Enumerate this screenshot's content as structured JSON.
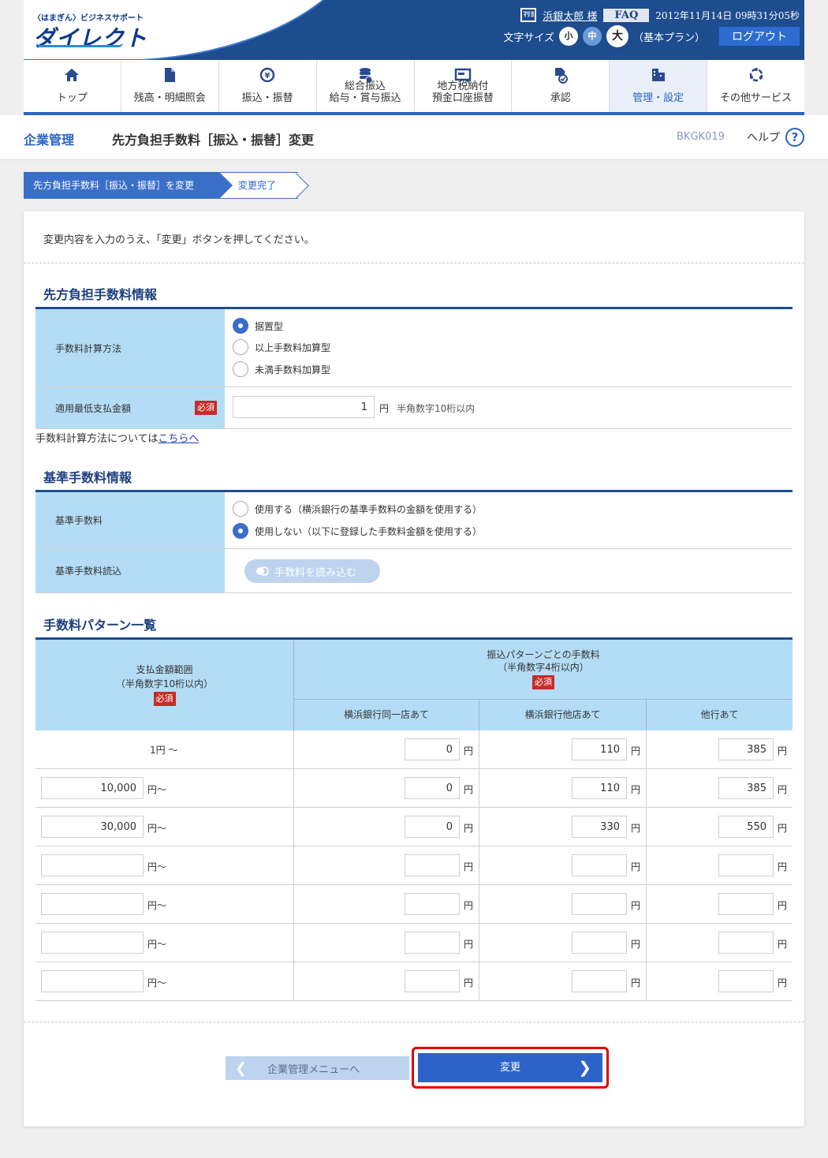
{
  "header": {
    "logo_small": "〈はまぎん〉ビジネスサポート",
    "logo_big": "ダイレクト",
    "user_icon_text": "ﾏﾘﾖ",
    "user_name": "浜銀太郎 様",
    "faq": "FAQ",
    "datetime": "2012年11月14日 09時31分05秒",
    "font_size_label": "文字サイズ",
    "font_small": "小",
    "font_mid": "中",
    "font_large": "大",
    "plan": "（基本プラン）",
    "logout": "ログアウト"
  },
  "nav": {
    "items": [
      {
        "label": "トップ",
        "icon": "home-icon"
      },
      {
        "label": "残高・明細照会",
        "icon": "document-icon"
      },
      {
        "label": "振込・振替",
        "icon": "yen-transfer-icon"
      },
      {
        "label": "総合振込\n給与・賞与振込",
        "icon": "coin-stack-icon"
      },
      {
        "label": "地方税納付\n預金口座振替",
        "icon": "card-icon"
      },
      {
        "label": "承認",
        "icon": "approval-icon"
      },
      {
        "label": "管理・設定",
        "icon": "settings-building-icon"
      },
      {
        "label": "その他サービス",
        "icon": "services-icon"
      }
    ]
  },
  "titlebar": {
    "crumb": "企業管理",
    "title": "先方負担手数料［振込・振替］変更",
    "screen_id": "BKGK019",
    "help": "ヘルプ",
    "help_icon": "?"
  },
  "steps": {
    "step1": "先方負担手数料［振込・振替］を変更",
    "step2": "変更完了"
  },
  "instruction": "変更内容を入力のうえ、「変更」ボタンを押してください。",
  "section1": {
    "title": "先方負担手数料情報",
    "calc_label": "手数料計算方法",
    "calc_options": [
      "据置型",
      "以上手数料加算型",
      "未満手数料加算型"
    ],
    "min_label": "適用最低支払金額",
    "required": "必須",
    "min_value": "1",
    "unit_yen": "円",
    "min_hint": "半角数字10桁以内",
    "note_prefix": "手数料計算方法については",
    "note_link": "こちらへ"
  },
  "section2": {
    "title": "基準手数料情報",
    "base_label": "基準手数料",
    "base_options": [
      "使用する（横浜銀行の基準手数料の金額を使用する）",
      "使用しない（以下に登録した手数料金額を使用する）"
    ],
    "load_label": "基準手数料読込",
    "load_button": "手数料を読み込む"
  },
  "section3": {
    "title": "手数料パターン一覧",
    "col_range_1": "支払金額範囲",
    "col_range_2": "（半角数字10桁以内）",
    "col_fee_1": "振込パターンごとの手数料",
    "col_fee_2": "（半角数字4桁以内）",
    "required": "必須",
    "col_same": "横浜銀行同一店あて",
    "col_other_branch": "横浜銀行他店あて",
    "col_other_bank": "他行あて",
    "yen": "円",
    "yen_from": "円～",
    "first_row_label": "1円 ～",
    "rows": [
      {
        "from": "",
        "same": "0",
        "branch": "110",
        "bank": "385"
      },
      {
        "from": "10,000",
        "same": "0",
        "branch": "110",
        "bank": "385"
      },
      {
        "from": "30,000",
        "same": "0",
        "branch": "330",
        "bank": "550"
      },
      {
        "from": "",
        "same": "",
        "branch": "",
        "bank": ""
      },
      {
        "from": "",
        "same": "",
        "branch": "",
        "bank": ""
      },
      {
        "from": "",
        "same": "",
        "branch": "",
        "bank": ""
      },
      {
        "from": "",
        "same": "",
        "branch": "",
        "bank": ""
      }
    ]
  },
  "footer": {
    "back": "企業管理メニューへ",
    "submit": "変更"
  },
  "colors": {
    "header_blue": "#1d4c8f",
    "accent": "#2b63c6",
    "label_bg": "#b4dcf6",
    "required": "#c72b28",
    "highlight": "#e10000"
  }
}
